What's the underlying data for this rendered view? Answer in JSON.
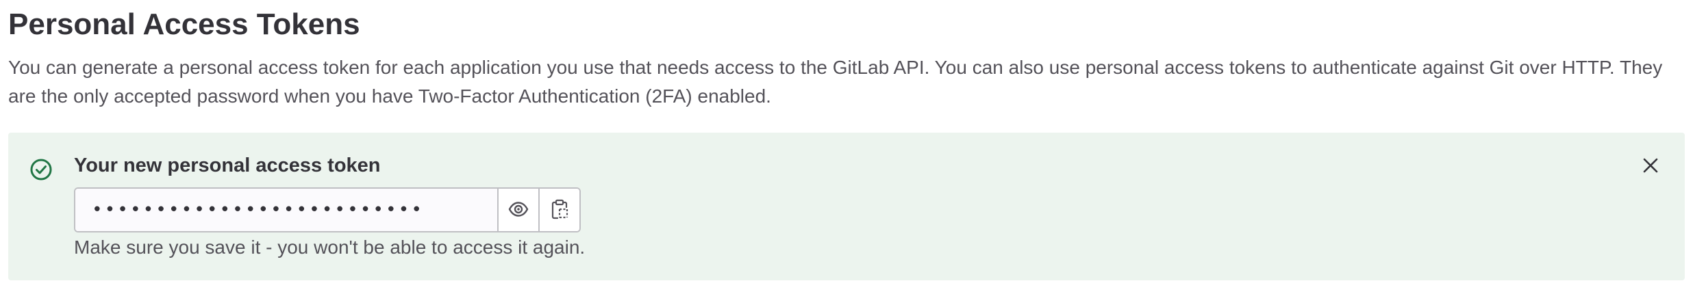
{
  "page": {
    "title": "Personal Access Tokens",
    "description": "You can generate a personal access token for each application you use that needs access to the GitLab API. You can also use personal access tokens to authenticate against Git over HTTP. They are the only accepted password when you have Two-Factor Authentication (2FA) enabled."
  },
  "alert": {
    "title": "Your new personal access token",
    "token_value": "••••••••••••••••••••••••••",
    "help_text": "Make sure you save it - you won't be able to access it again.",
    "icon": "check-circle-icon",
    "close_icon": "close-icon",
    "reveal_icon": "eye-icon",
    "copy_icon": "clipboard-icon"
  },
  "colors": {
    "alert_background": "#ecf4ee",
    "success_icon": "#217645",
    "text": "#333238",
    "muted_text": "#535158",
    "border": "#bfbfc3"
  }
}
